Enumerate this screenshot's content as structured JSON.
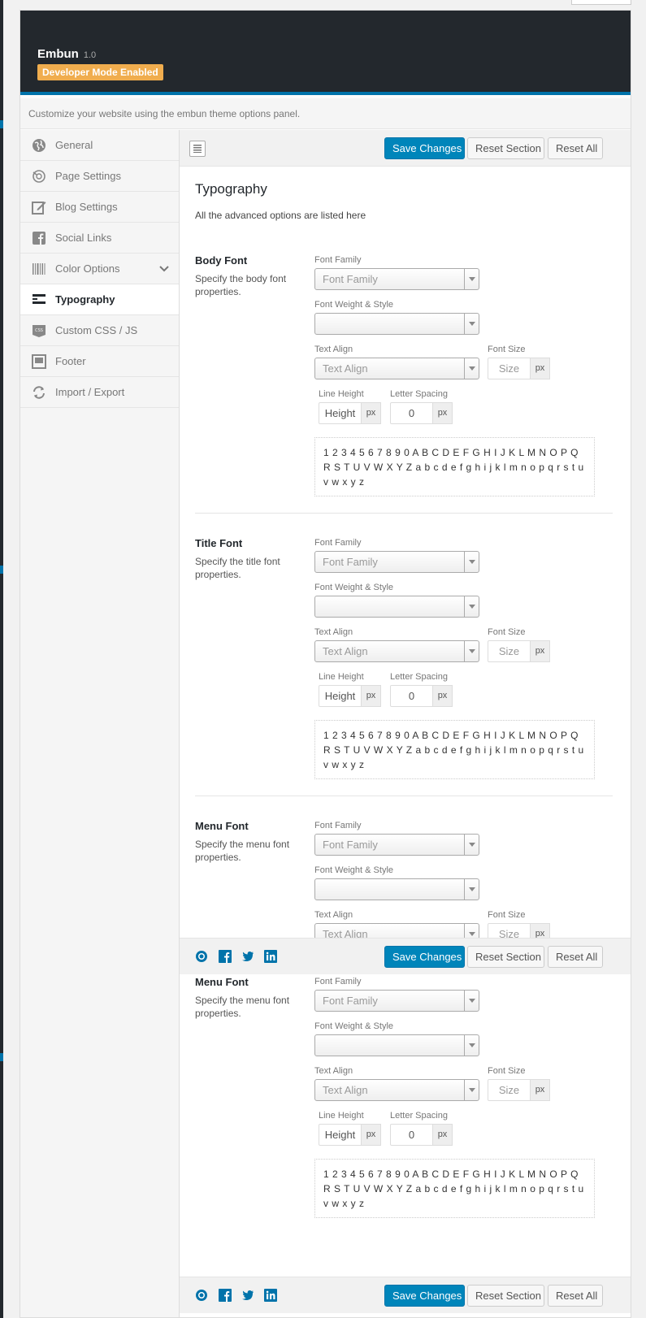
{
  "header": {
    "title": "Embun",
    "version": "1.0",
    "badge": "Developer Mode Enabled"
  },
  "intro": "Customize your website using the embun theme options panel.",
  "sidebar": {
    "items": [
      {
        "label": "General",
        "icon": "globe-icon"
      },
      {
        "label": "Page Settings",
        "icon": "page-settings-icon"
      },
      {
        "label": "Blog Settings",
        "icon": "edit-icon"
      },
      {
        "label": "Social Links",
        "icon": "facebook-icon"
      },
      {
        "label": "Color Options",
        "icon": "barcode-icon"
      },
      {
        "label": "Typography",
        "icon": "typography-icon",
        "active": true
      },
      {
        "label": "Custom CSS / JS",
        "icon": "css-icon"
      },
      {
        "label": "Footer",
        "icon": "footer-icon"
      },
      {
        "label": "Import / Export",
        "icon": "refresh-icon"
      }
    ]
  },
  "toolbar": {
    "save": "Save Changes",
    "reset_section": "Reset Section",
    "reset_all": "Reset All"
  },
  "section": {
    "title": "Typography",
    "desc": "All the advanced options are listed here"
  },
  "labels": {
    "font_family": "Font Family",
    "font_weight": "Font Weight & Style",
    "text_align": "Text Align",
    "font_size": "Font Size",
    "line_height": "Line Height",
    "letter_spacing": "Letter Spacing"
  },
  "placeholders": {
    "font_family": "Font Family",
    "text_align": "Text Align",
    "size": "Size",
    "height": "Height",
    "unit": "px"
  },
  "letter_spacing_value": "0",
  "preview_text": "1 2 3 4 5 6 7 8 9 0 A B C D E F G H I J K L M N O P Q R S T U V W X Y Z a b c d e f g h i j k l m n o p q r s t u v w x y z",
  "fields": [
    {
      "title": "Body Font",
      "desc": "Specify the body font properties."
    },
    {
      "title": "Title Font",
      "desc": "Specify the title font properties."
    },
    {
      "title": "Menu Font",
      "desc": "Specify the menu font properties."
    }
  ],
  "colors": {
    "header_bg": "#23282d",
    "accent": "#0073aa",
    "badge": "#f0ad4e",
    "primary_button": "#0085ba"
  }
}
